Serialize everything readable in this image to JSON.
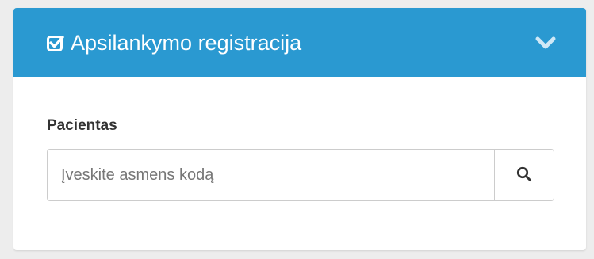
{
  "panel": {
    "title": "Apsilankymo registracija",
    "header_icon": "check-square-icon",
    "toggle_icon": "chevron-down-icon",
    "header_color": "#2a99d1"
  },
  "patient_field": {
    "label": "Pacientas",
    "placeholder": "Įveskite asmens kodą",
    "value": "",
    "search_icon": "search-icon"
  }
}
